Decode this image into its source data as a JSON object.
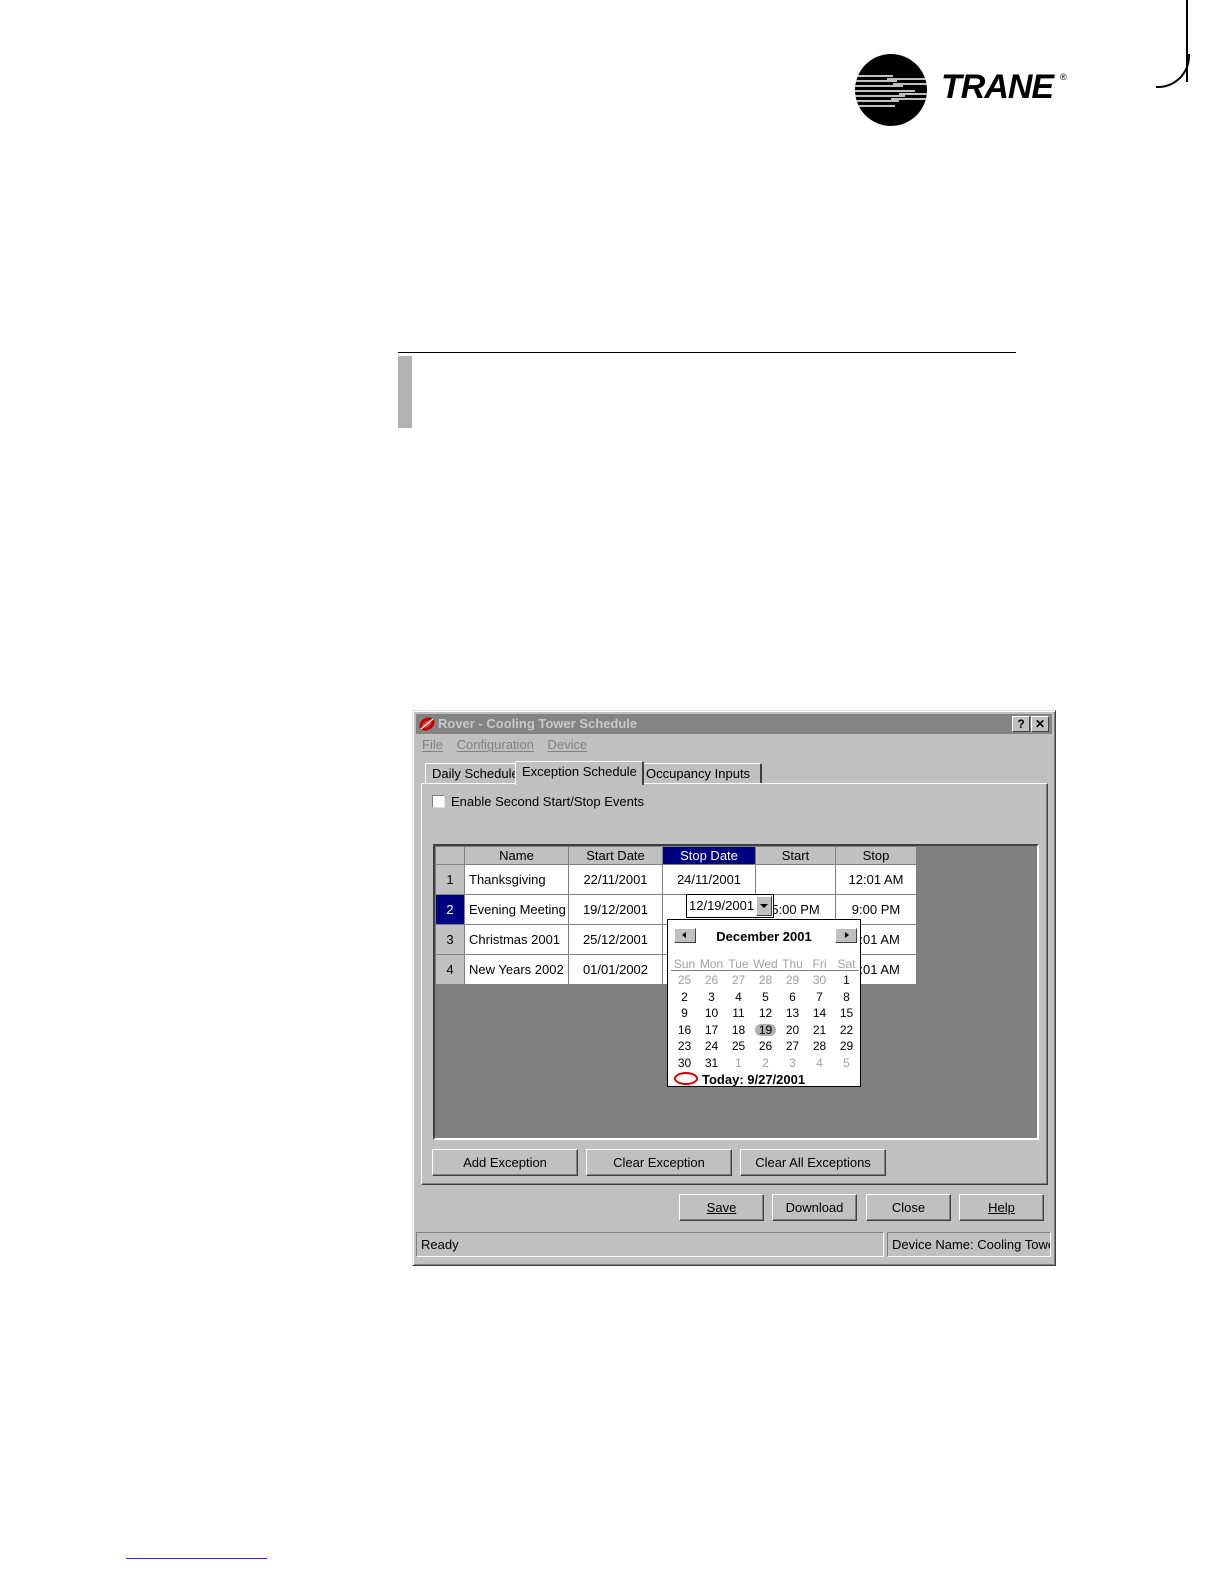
{
  "brand": {
    "name": "TRANE",
    "registered": "®"
  },
  "window": {
    "title": "Rover - Cooling Tower Schedule",
    "help_button": "?",
    "close_button": "✕"
  },
  "menu": [
    {
      "label": "File"
    },
    {
      "label": "Configuration"
    },
    {
      "label": "Device"
    }
  ],
  "tabs": [
    {
      "label": "Daily Schedule",
      "active": false
    },
    {
      "label": "Exception Schedule",
      "active": true
    },
    {
      "label": "Occupancy Inputs",
      "active": false
    }
  ],
  "enable_second_events": {
    "label": "Enable Second Start/Stop Events",
    "checked": false
  },
  "grid": {
    "columns": [
      "Name",
      "Start Date",
      "Stop Date",
      "Start",
      "Stop"
    ],
    "selected_column": "Stop Date",
    "selected_row": 2,
    "rows": [
      {
        "num": "1",
        "name": "Thanksgiving",
        "start_date": "22/11/2001",
        "stop_date": "24/11/2001",
        "start": "",
        "stop": "12:01 AM"
      },
      {
        "num": "2",
        "name": "Evening Meeting",
        "start_date": "19/12/2001",
        "stop_date": "",
        "start": "5:00 PM",
        "stop": "9:00 PM"
      },
      {
        "num": "3",
        "name": "Christmas 2001",
        "start_date": "25/12/2001",
        "stop_date": "",
        "start": "",
        "stop": "2:01 AM"
      },
      {
        "num": "4",
        "name": "New Years 2002",
        "start_date": "01/01/2002",
        "stop_date": "",
        "start": "",
        "stop": "2:01 AM"
      }
    ],
    "editor_value": "12/19/2001"
  },
  "calendar": {
    "month_label": "December 2001",
    "weekdays": [
      "Sun",
      "Mon",
      "Tue",
      "Wed",
      "Thu",
      "Fri",
      "Sat"
    ],
    "weeks": [
      [
        "25",
        "26",
        "27",
        "28",
        "29",
        "30",
        "1"
      ],
      [
        "2",
        "3",
        "4",
        "5",
        "6",
        "7",
        "8"
      ],
      [
        "9",
        "10",
        "11",
        "12",
        "13",
        "14",
        "15"
      ],
      [
        "16",
        "17",
        "18",
        "19",
        "20",
        "21",
        "22"
      ],
      [
        "23",
        "24",
        "25",
        "26",
        "27",
        "28",
        "29"
      ],
      [
        "30",
        "31",
        "1",
        "2",
        "3",
        "4",
        "5"
      ]
    ],
    "selected_day": "19",
    "today_label": "Today: 9/27/2001"
  },
  "buttons": {
    "add_exception": "Add Exception",
    "clear_exception": "Clear Exception",
    "clear_all_exceptions": "Clear All Exceptions",
    "save": "Save",
    "download": "Download",
    "close": "Close",
    "help": "Help"
  },
  "status": {
    "left": "Ready",
    "right": "Device Name: Cooling Tower"
  }
}
